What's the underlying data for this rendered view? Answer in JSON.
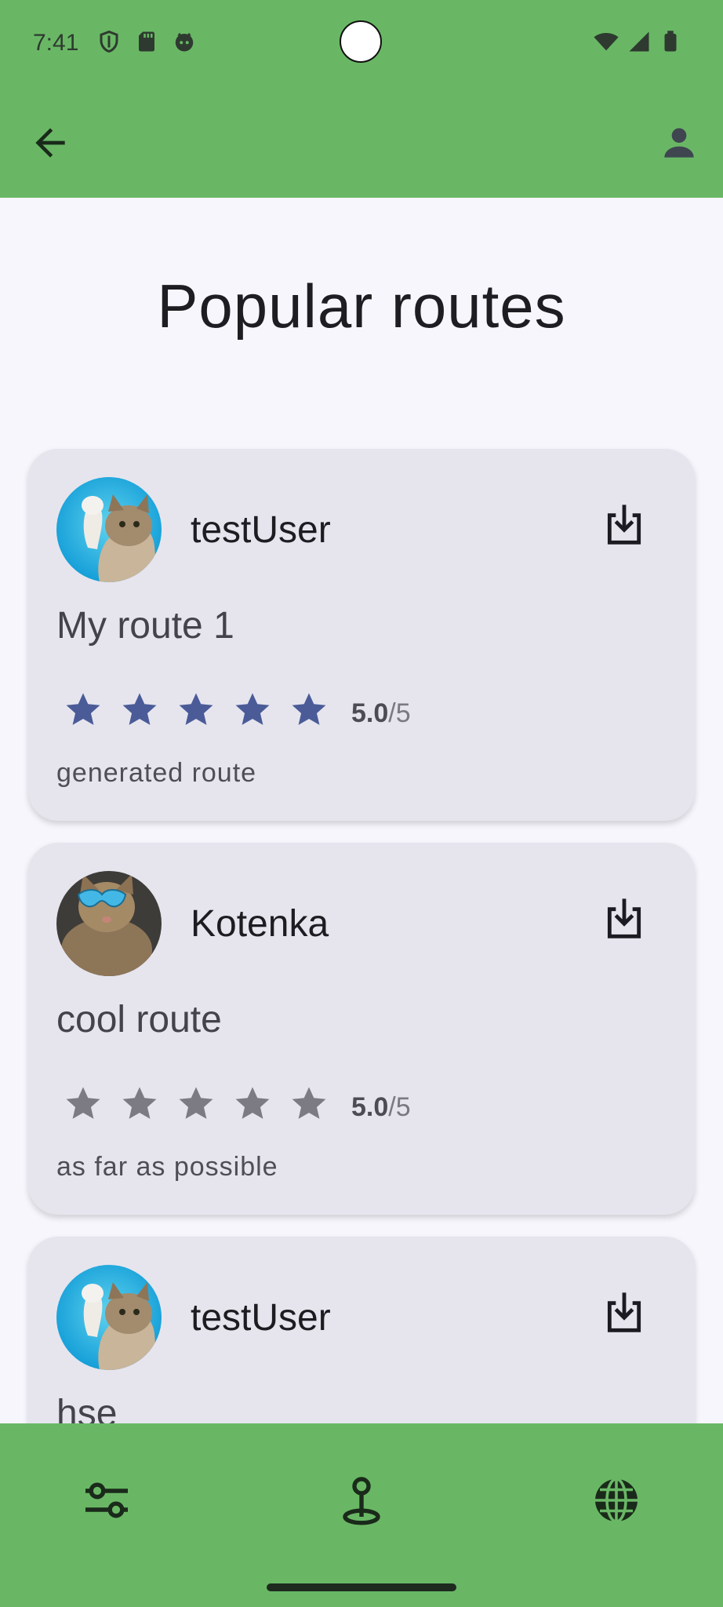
{
  "status_bar": {
    "time": "7:41",
    "left_icons": [
      "shield-icon",
      "sd-card-icon",
      "face-icon"
    ],
    "right_icons": [
      "wifi-icon",
      "signal-icon",
      "battery-icon"
    ]
  },
  "app_bar": {
    "back_icon": "arrow-back-icon",
    "profile_icon": "person-icon",
    "color": "#69b765"
  },
  "page": {
    "title": "Popular routes"
  },
  "routes": [
    {
      "username": "testUser",
      "avatar": "cat-waving-avatar",
      "title": "My route 1",
      "rating": "5.0",
      "rating_max": "/5",
      "stars": 5,
      "star_color": "#4a5b98",
      "description": "generated route"
    },
    {
      "username": "Kotenka",
      "avatar": "cat-sunglasses-avatar",
      "title": "cool route",
      "rating": "5.0",
      "rating_max": "/5",
      "stars": 5,
      "star_color": "#7c7b83",
      "description": "as far as possible"
    },
    {
      "username": "testUser",
      "avatar": "cat-waving-avatar",
      "title": "hse",
      "rating": "",
      "rating_max": "",
      "stars": 0,
      "star_color": "#7c7b83",
      "description": ""
    }
  ],
  "bottom_nav": {
    "items": [
      {
        "icon": "sliders-icon",
        "label": "filters"
      },
      {
        "icon": "location-pin-icon",
        "label": "map"
      },
      {
        "icon": "globe-icon",
        "label": "world"
      }
    ],
    "color": "#69b765"
  }
}
